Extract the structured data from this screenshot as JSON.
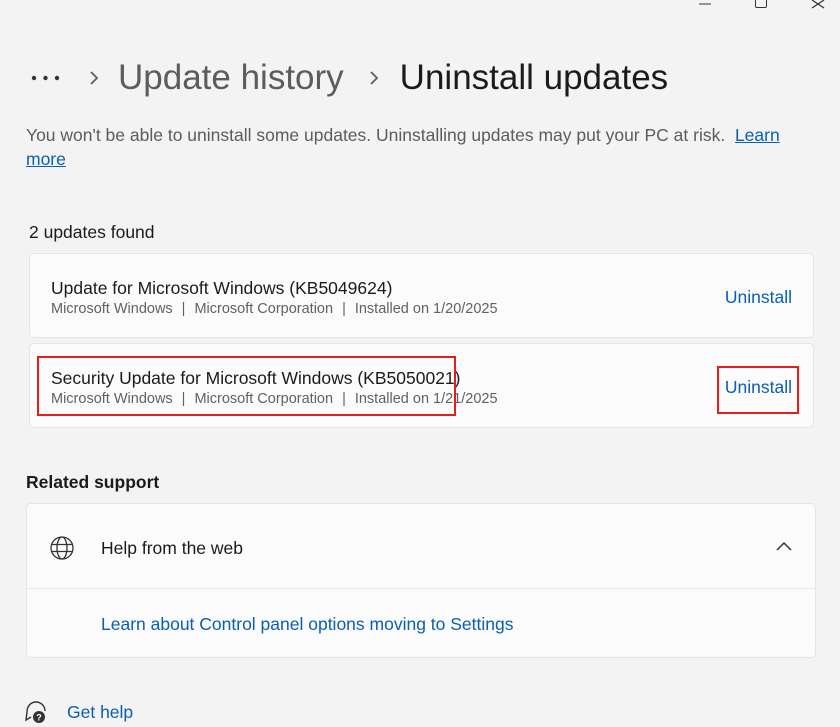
{
  "window_controls": {
    "minimize_icon": "minimize-icon",
    "maximize_icon": "maximize-icon",
    "close_icon": "close-icon"
  },
  "breadcrumb": {
    "more_icon": "ellipsis-icon",
    "previous": "Update history",
    "current": "Uninstall updates"
  },
  "description": {
    "text": "You won't be able to uninstall some updates. Uninstalling updates may put your PC at risk.",
    "link": "Learn more"
  },
  "updates": {
    "count_label": "2 updates found",
    "items": [
      {
        "title": "Update for Microsoft Windows (KB5049624)",
        "product": "Microsoft Windows",
        "publisher": "Microsoft Corporation",
        "installed": "Installed on 1/20/2025",
        "action": "Uninstall"
      },
      {
        "title": "Security Update for Microsoft Windows (KB5050021)",
        "product": "Microsoft Windows",
        "publisher": "Microsoft Corporation",
        "installed": "Installed on 1/21/2025",
        "action": "Uninstall"
      }
    ],
    "separator": "|"
  },
  "related_support": {
    "title": "Related support",
    "help_from_web": "Help from the web",
    "help_icon": "globe-icon",
    "link": "Learn about Control panel options moving to Settings"
  },
  "get_help": {
    "label": "Get help",
    "icon": "help-chat-icon"
  },
  "colors": {
    "accent": "#0a5fb4",
    "highlight": "#e01e1e",
    "background": "#f3f3f3"
  }
}
